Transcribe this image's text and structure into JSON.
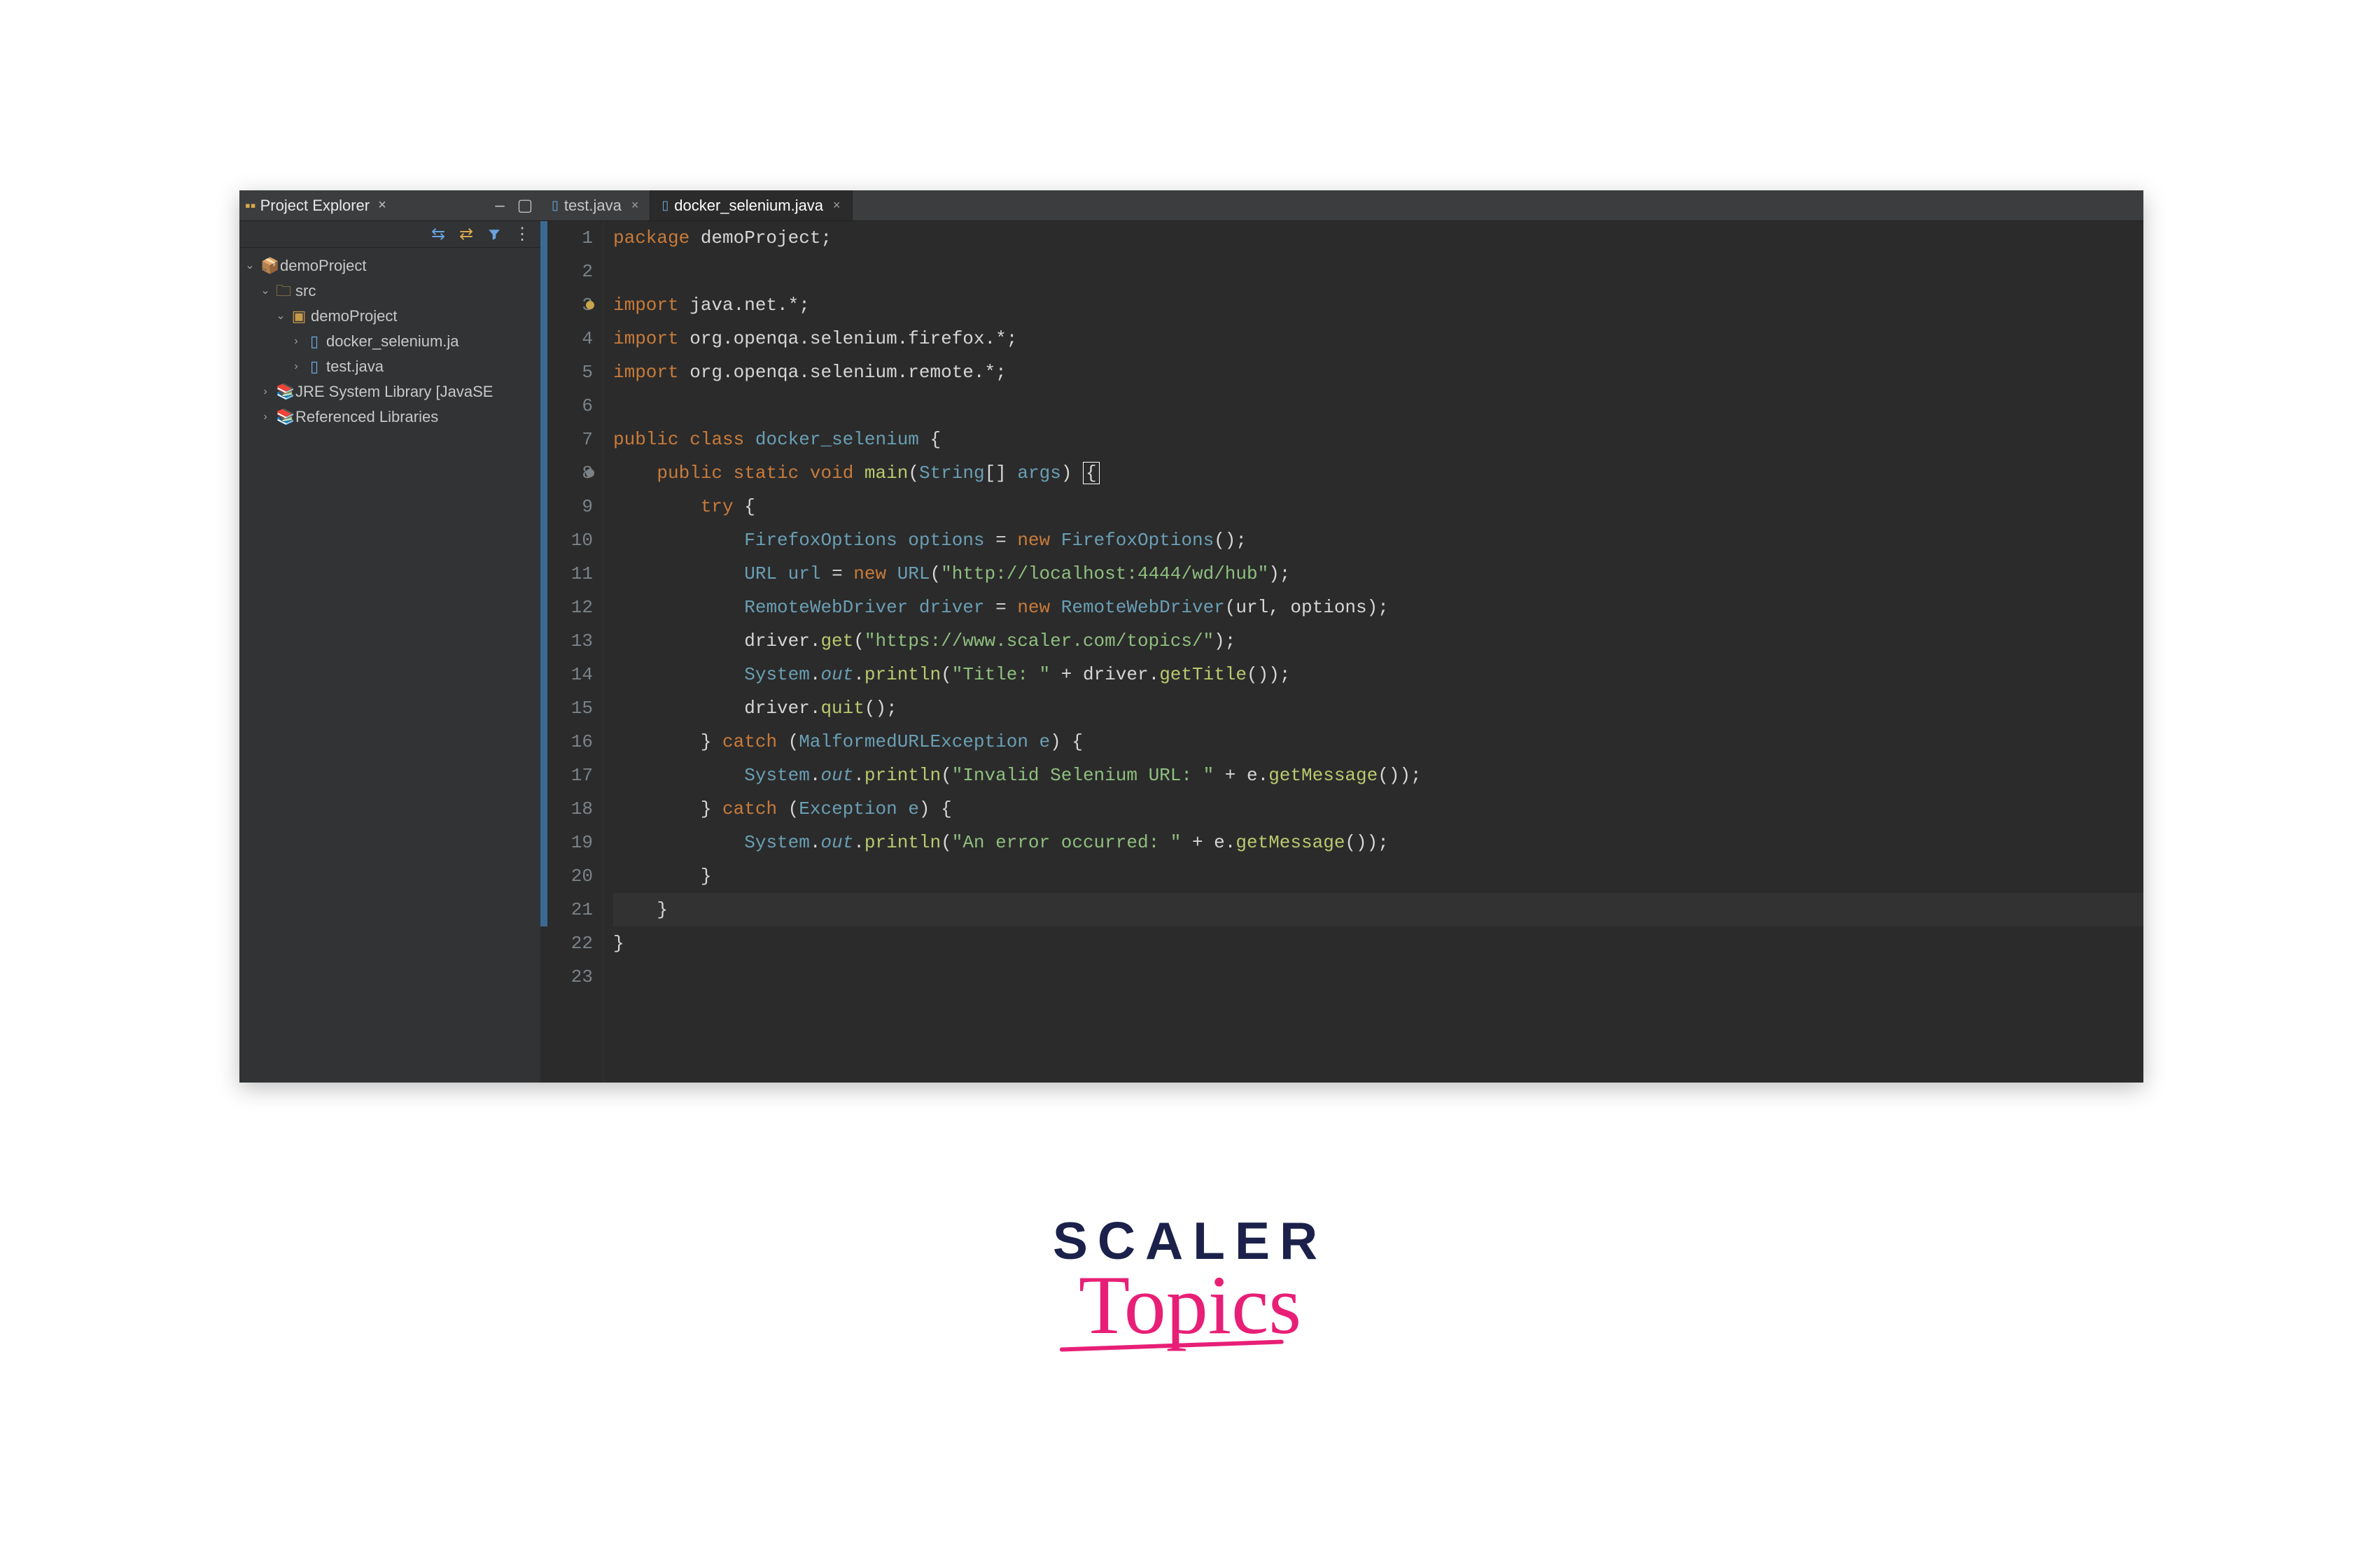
{
  "sidebar": {
    "title": "Project Explorer",
    "tree": [
      {
        "label": "demoProject",
        "arrow": "⌄",
        "iconClass": "proj-icon",
        "icon": "📦",
        "indent": 0
      },
      {
        "label": "src",
        "arrow": "⌄",
        "iconClass": "src-icon",
        "icon": "🗀",
        "indent": 1
      },
      {
        "label": "demoProject",
        "arrow": "⌄",
        "iconClass": "pkg-icon",
        "icon": "▣",
        "indent": 2
      },
      {
        "label": "docker_selenium.ja",
        "arrow": "›",
        "iconClass": "java-icon",
        "icon": "▯",
        "indent": 3
      },
      {
        "label": "test.java",
        "arrow": "›",
        "iconClass": "java-icon",
        "icon": "▯",
        "indent": 3
      },
      {
        "label": "JRE System Library [JavaSE",
        "arrow": "›",
        "iconClass": "lib-icon",
        "icon": "📚",
        "indent": 1
      },
      {
        "label": "Referenced Libraries",
        "arrow": "›",
        "iconClass": "lib-icon",
        "icon": "📚",
        "indent": 1
      }
    ]
  },
  "tabs": [
    {
      "label": "test.java",
      "active": false
    },
    {
      "label": "docker_selenium.java",
      "active": true
    }
  ],
  "code": {
    "lines": [
      {
        "n": 1,
        "marker": "",
        "html": "<span class='kw'>package</span> demoProject;"
      },
      {
        "n": 2,
        "marker": "",
        "html": ""
      },
      {
        "n": 3,
        "marker": "warn",
        "html": "<span class='kw'>import</span> java.net.*;"
      },
      {
        "n": 4,
        "marker": "",
        "html": "<span class='kw'>import</span> org.openqa.selenium.firefox.*;"
      },
      {
        "n": 5,
        "marker": "",
        "html": "<span class='kw'>import</span> org.openqa.selenium.remote.*;"
      },
      {
        "n": 6,
        "marker": "",
        "html": ""
      },
      {
        "n": 7,
        "marker": "",
        "html": "<span class='kw'>public</span> <span class='kw'>class</span> <span class='cls'>docker_selenium</span> {"
      },
      {
        "n": 8,
        "marker": "gray",
        "html": "    <span class='kw'>public</span> <span class='kw'>static</span> <span class='kw'>void</span> <span class='fn'>main</span>(<span class='typ'>String</span>[] <span class='typ'>args</span>) <span class='caret'>{</span>"
      },
      {
        "n": 9,
        "marker": "",
        "html": "        <span class='kw'>try</span> {"
      },
      {
        "n": 10,
        "marker": "",
        "html": "            <span class='typ'>FirefoxOptions</span> <span class='typ'>options</span> = <span class='kw'>new</span> <span class='typ'>FirefoxOptions</span>();"
      },
      {
        "n": 11,
        "marker": "",
        "html": "            <span class='typ'>URL</span> <span class='typ'>url</span> = <span class='kw'>new</span> <span class='typ'>URL</span>(<span class='str'>\"http://localhost:4444/wd/hub\"</span>);"
      },
      {
        "n": 12,
        "marker": "",
        "html": "            <span class='typ'>RemoteWebDriver</span> <span class='typ'>driver</span> = <span class='kw'>new</span> <span class='typ'>RemoteWebDriver</span>(url, options);"
      },
      {
        "n": 13,
        "marker": "",
        "html": "            driver.<span class='fn'>get</span>(<span class='str'>\"https://www.scaler.com/topics/\"</span>);"
      },
      {
        "n": 14,
        "marker": "",
        "html": "            <span class='typ'>System</span>.<span class='fld'>out</span>.<span class='fn'>println</span>(<span class='str'>\"Title: \"</span> + driver.<span class='fn'>getTitle</span>());"
      },
      {
        "n": 15,
        "marker": "",
        "html": "            driver.<span class='fn'>quit</span>();"
      },
      {
        "n": 16,
        "marker": "",
        "html": "        } <span class='kw'>catch</span> (<span class='typ'>MalformedURLException</span> <span class='typ'>e</span>) {"
      },
      {
        "n": 17,
        "marker": "",
        "html": "            <span class='typ'>System</span>.<span class='fld'>out</span>.<span class='fn'>println</span>(<span class='str'>\"Invalid Selenium URL: \"</span> + e.<span class='fn'>getMessage</span>());"
      },
      {
        "n": 18,
        "marker": "",
        "html": "        } <span class='kw'>catch</span> (<span class='typ'>Exception</span> <span class='typ'>e</span>) {"
      },
      {
        "n": 19,
        "marker": "",
        "html": "            <span class='typ'>System</span>.<span class='fld'>out</span>.<span class='fn'>println</span>(<span class='str'>\"An error occurred: \"</span> + e.<span class='fn'>getMessage</span>());"
      },
      {
        "n": 20,
        "marker": "",
        "html": "        }"
      },
      {
        "n": 21,
        "marker": "",
        "html": "    }",
        "current": true
      },
      {
        "n": 22,
        "marker": "",
        "html": "}"
      },
      {
        "n": 23,
        "marker": "",
        "html": ""
      }
    ]
  },
  "logo": {
    "line1": "SCALER",
    "line2": "Topics"
  }
}
